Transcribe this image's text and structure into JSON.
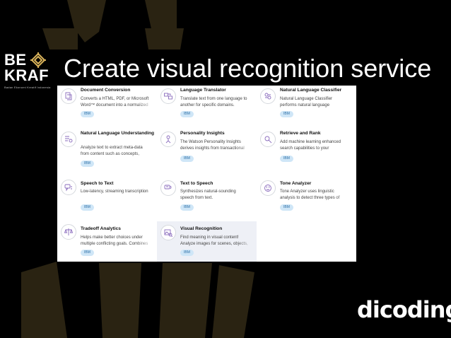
{
  "slide": {
    "title": "Create visual recognition service"
  },
  "logo": {
    "line1": "BE",
    "line2": "KRAF",
    "tagline": "Badan Ekonomi Kreatif Indonesia"
  },
  "brand": {
    "name": "dicoding"
  },
  "services": [
    {
      "name": "Document Conversion",
      "desc1": "Converts a HTML, PDF, or Microsoft",
      "desc2": "Word™ document into a normalized",
      "badge": "IBM",
      "icon": "document-conversion-icon"
    },
    {
      "name": "Language Translator",
      "desc1": "Translate text from one language to",
      "desc2": "another for specific domains.",
      "badge": "IBM",
      "icon": "language-translator-icon"
    },
    {
      "name": "Natural Language Classifier",
      "desc1": "Natural Language Classifier",
      "desc2": "performs natural language",
      "badge": "IBM",
      "icon": "language-classifier-icon"
    },
    {
      "name": "Natural Language Understanding",
      "desc1": "Analyze text to extract meta-data",
      "desc2": "from content such as concepts,",
      "badge": "IBM",
      "icon": "language-understanding-icon"
    },
    {
      "name": "Personality Insights",
      "desc1": "The Watson Personality Insights",
      "desc2": "derives insights from transactional",
      "badge": "IBM",
      "icon": "personality-insights-icon"
    },
    {
      "name": "Retrieve and Rank",
      "desc1": "Add machine learning enhanced",
      "desc2": "search capabilities to your",
      "badge": "IBM",
      "icon": "retrieve-rank-icon"
    },
    {
      "name": "Speech to Text",
      "desc1": "Low-latency, streaming transcription",
      "desc2": "",
      "badge": "IBM",
      "icon": "speech-to-text-icon"
    },
    {
      "name": "Text to Speech",
      "desc1": "Synthesizes natural-sounding",
      "desc2": "speech from text.",
      "badge": "IBM",
      "icon": "text-to-speech-icon"
    },
    {
      "name": "Tone Analyzer",
      "desc1": "Tone Analyzer uses linguistic",
      "desc2": "analysis to detect three types of",
      "badge": "IBM",
      "icon": "tone-analyzer-icon"
    },
    {
      "name": "Tradeoff Analytics",
      "desc1": "Helps make better choices under",
      "desc2": "multiple conflicting goals. Combines",
      "badge": "IBM",
      "icon": "tradeoff-analytics-icon"
    },
    {
      "name": "Visual Recognition",
      "desc1": "Find meaning in visual content!",
      "desc2": "Analyze images for scenes, objects,",
      "badge": "IBM",
      "icon": "visual-recognition-icon"
    }
  ],
  "colors": {
    "background": "#000000",
    "badge_bg": "#cfe6f7",
    "badge_text": "#2b6ea6",
    "selected_card": "#eef0f6",
    "decor": "#2a2312"
  }
}
